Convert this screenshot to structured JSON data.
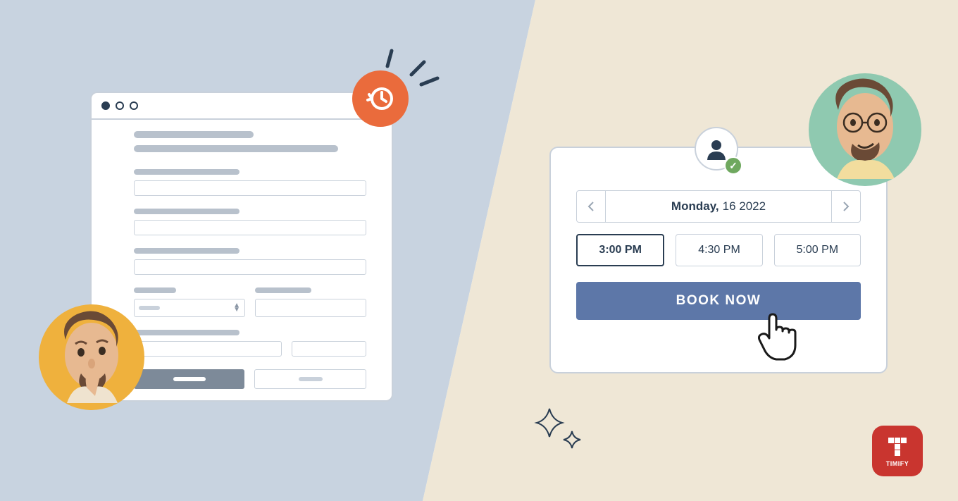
{
  "booking": {
    "date_day": "Monday,",
    "date_rest": "16 2022",
    "slots": [
      "3:00 PM",
      "4:30 PM",
      "5:00 PM"
    ],
    "book_label": "BOOK NOW"
  },
  "logo": {
    "name": "TIMIFY"
  },
  "colors": {
    "accent_orange": "#ea6b3c",
    "accent_blue": "#5d77a8",
    "accent_green": "#6fa85f",
    "brand_red": "#c9352f"
  }
}
